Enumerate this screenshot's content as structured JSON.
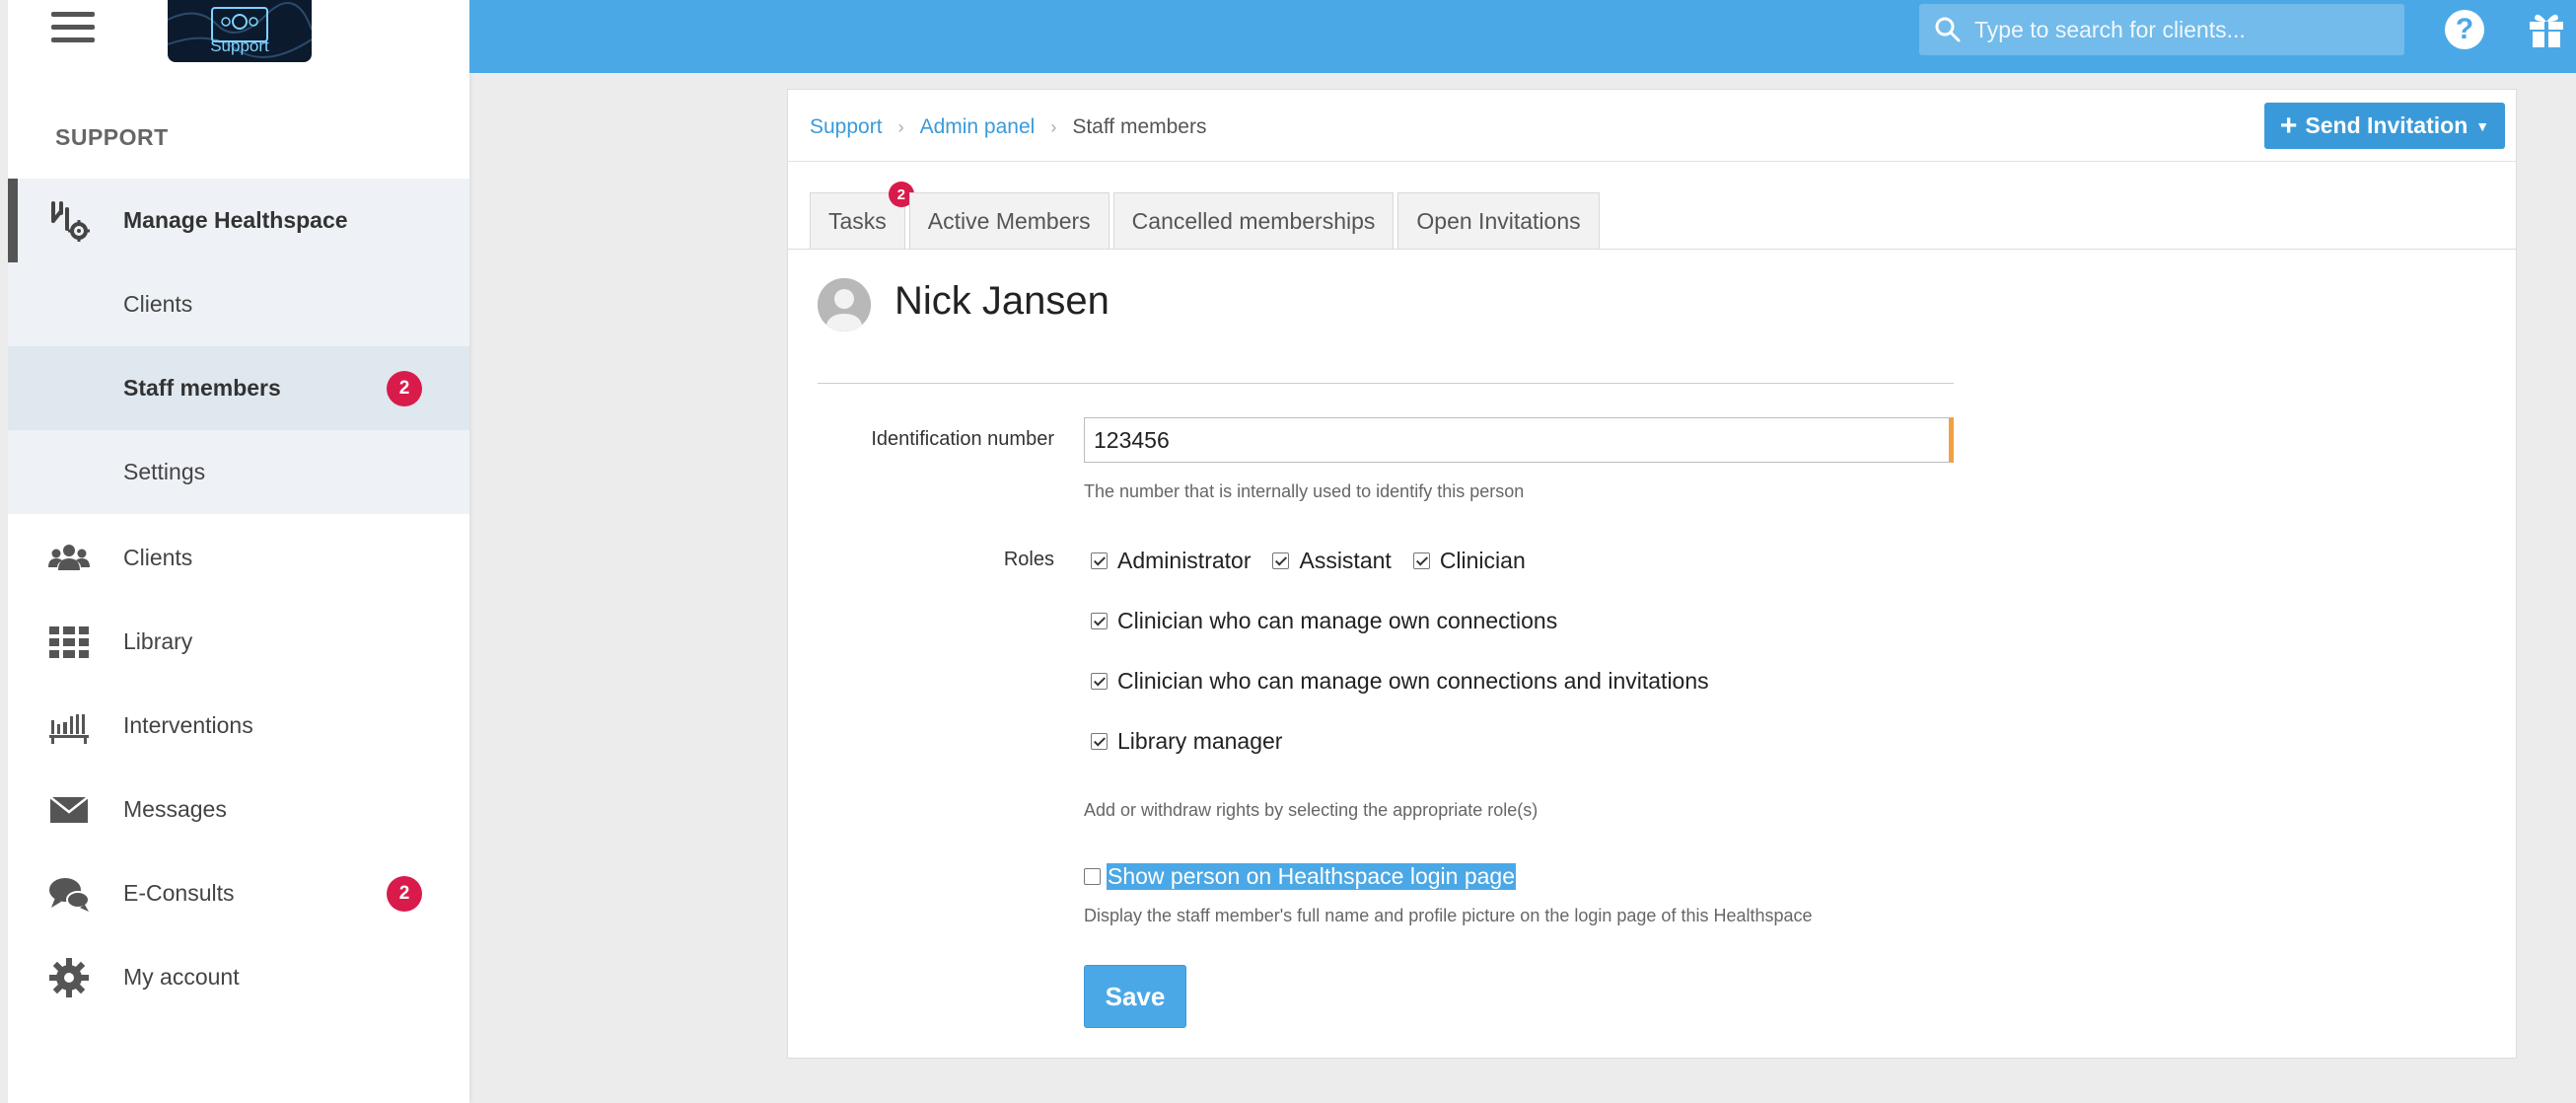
{
  "sidebar": {
    "logo_text": "Support",
    "section_title": "SUPPORT",
    "items": [
      {
        "label": "Manage Healthspace",
        "icon": "manage-healthspace-icon"
      },
      {
        "label": "Clients"
      },
      {
        "label": "Staff members",
        "badge": "2"
      },
      {
        "label": "Settings"
      },
      {
        "label": "Clients",
        "icon": "users-icon"
      },
      {
        "label": "Library",
        "icon": "grid-icon"
      },
      {
        "label": "Interventions",
        "icon": "bookshelf-icon"
      },
      {
        "label": "Messages",
        "icon": "envelope-icon"
      },
      {
        "label": "E-Consults",
        "icon": "chat-icon",
        "badge": "2"
      },
      {
        "label": "My account",
        "icon": "gear-icon"
      }
    ]
  },
  "topbar": {
    "search_placeholder": "Type to search for clients...",
    "help_label": "?"
  },
  "breadcrumb": {
    "items": [
      "Support",
      "Admin panel",
      "Staff members"
    ]
  },
  "actions": {
    "send_invitation": "Send Invitation"
  },
  "tabs": [
    {
      "label": "Tasks",
      "badge": "2"
    },
    {
      "label": "Active Members"
    },
    {
      "label": "Cancelled memberships"
    },
    {
      "label": "Open Invitations"
    }
  ],
  "person": {
    "name": "Nick Jansen"
  },
  "form": {
    "id_label": "Identification number",
    "id_value": "123456",
    "id_help": "The number that is internally used to identify this person",
    "roles_label": "Roles",
    "roles": [
      {
        "label": "Administrator",
        "checked": true
      },
      {
        "label": "Assistant",
        "checked": true
      },
      {
        "label": "Clinician",
        "checked": true
      },
      {
        "label": "Clinician who can manage own connections",
        "checked": true
      },
      {
        "label": "Clinician who can manage own connections and invitations",
        "checked": true
      },
      {
        "label": "Library manager",
        "checked": true
      }
    ],
    "roles_help": "Add or withdraw rights by selecting the appropriate role(s)",
    "show_on_login_label": "Show person on Healthspace login page",
    "show_on_login_checked": false,
    "show_on_login_help": "Display the staff member's full name and profile picture on the login page of this Healthspace",
    "save_label": "Save"
  },
  "colors": {
    "topbar": "#4ba8e6",
    "accent": "#3a9ad9",
    "badge": "#d81b4b",
    "input_marker": "#f0a040"
  }
}
